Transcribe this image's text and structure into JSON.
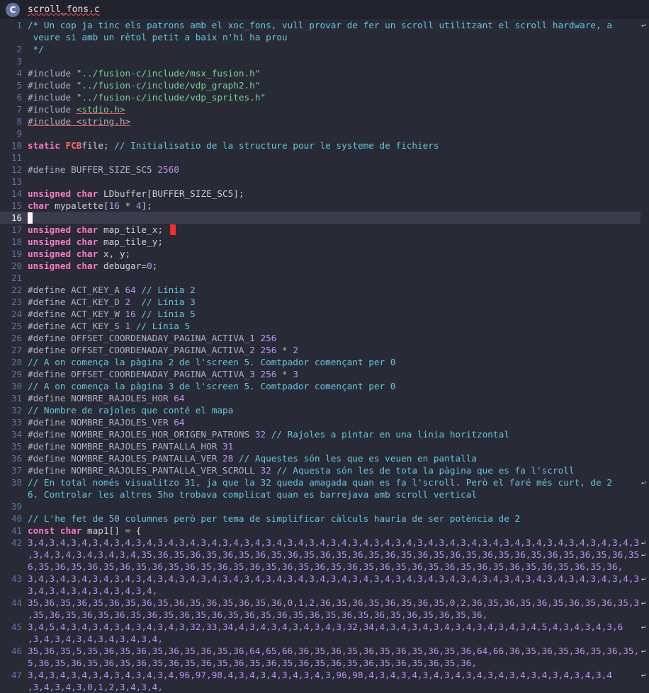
{
  "tab": {
    "icon": "c-language-icon",
    "icon_glyph": "C",
    "filename": "scroll_fons.c"
  },
  "editor": {
    "current_line": 16,
    "lines": [
      {
        "n": "1",
        "rows": [
          [
            [
              "cm",
              "/* Un cop ja tinc els patrons amb el xoc_fons, vull provar de fer un scroll utilitzant el scroll hardware, a"
            ]
          ],
          [
            [
              "cm",
              " veure si amb un rètol petit a baix n'hi ha prou"
            ]
          ]
        ]
      },
      {
        "n": "2",
        "rows": [
          [
            [
              "cm",
              " */"
            ]
          ]
        ]
      },
      {
        "n": "3",
        "rows": [
          []
        ]
      },
      {
        "n": "4",
        "rows": [
          [
            [
              "pp",
              "#include "
            ],
            [
              "str",
              "\"../fusion-c/include/msx_fusion.h\""
            ]
          ]
        ]
      },
      {
        "n": "5",
        "rows": [
          [
            [
              "pp",
              "#include "
            ],
            [
              "str",
              "\"../fusion-c/include/vdp_graph2.h\""
            ]
          ]
        ]
      },
      {
        "n": "6",
        "rows": [
          [
            [
              "pp",
              "#include "
            ],
            [
              "str",
              "\"../fusion-c/include/vdp_sprites.h\""
            ]
          ]
        ]
      },
      {
        "n": "7",
        "rows": [
          [
            [
              "pp",
              "#include "
            ],
            [
              "str",
              "<stdio.h>"
            ]
          ]
        ]
      },
      {
        "n": "8",
        "rows": [
          [
            [
              "pp",
              "#include <string.h>"
            ]
          ]
        ]
      },
      {
        "n": "9",
        "rows": [
          []
        ]
      },
      {
        "n": "10",
        "rows": [
          [
            [
              "kw",
              "static "
            ],
            [
              "ty",
              "FCB"
            ],
            [
              "",
              "file; "
            ],
            [
              "cm",
              "// Initialisatio de la structure pour le systeme de fichiers"
            ]
          ]
        ]
      },
      {
        "n": "11",
        "rows": [
          []
        ]
      },
      {
        "n": "12",
        "rows": [
          [
            [
              "pp",
              "#define BUFFER_SIZE_SC5 "
            ],
            [
              "num",
              "2560"
            ]
          ]
        ]
      },
      {
        "n": "13",
        "rows": [
          []
        ]
      },
      {
        "n": "14",
        "rows": [
          [
            [
              "kw",
              "unsigned char "
            ],
            [
              "",
              "LDbuffer[BUFFER_SIZE_SC5];"
            ]
          ]
        ]
      },
      {
        "n": "15",
        "rows": [
          [
            [
              "kw",
              "char "
            ],
            [
              "",
              "mypalette["
            ],
            [
              "num",
              "16"
            ],
            [
              "",
              " * "
            ],
            [
              "num",
              "4"
            ],
            [
              "",
              "];"
            ]
          ]
        ]
      },
      {
        "n": "16",
        "rows": [
          []
        ]
      },
      {
        "n": "17",
        "rows": [
          [
            [
              "kw",
              "unsigned char "
            ],
            [
              "",
              "map_tile_x;"
            ]
          ]
        ]
      },
      {
        "n": "18",
        "rows": [
          [
            [
              "kw",
              "unsigned char "
            ],
            [
              "",
              "map_tile_y;"
            ]
          ]
        ]
      },
      {
        "n": "19",
        "rows": [
          [
            [
              "kw",
              "unsigned char "
            ],
            [
              "",
              "x, y;"
            ]
          ]
        ]
      },
      {
        "n": "20",
        "rows": [
          [
            [
              "kw",
              "unsigned char "
            ],
            [
              "",
              "debugar="
            ],
            [
              "num",
              "0"
            ],
            [
              "",
              ";"
            ]
          ]
        ]
      },
      {
        "n": "21",
        "rows": [
          []
        ]
      },
      {
        "n": "22",
        "rows": [
          [
            [
              "pp",
              "#define ACT_KEY_A "
            ],
            [
              "num",
              "64"
            ],
            [
              "cm",
              " // Línia 2"
            ]
          ]
        ]
      },
      {
        "n": "23",
        "rows": [
          [
            [
              "pp",
              "#define ACT_KEY_D "
            ],
            [
              "num",
              "2"
            ],
            [
              "cm",
              "  // Línia 3"
            ]
          ]
        ]
      },
      {
        "n": "24",
        "rows": [
          [
            [
              "pp",
              "#define ACT_KEY_W "
            ],
            [
              "num",
              "16"
            ],
            [
              "cm",
              " // Línia 5"
            ]
          ]
        ]
      },
      {
        "n": "25",
        "rows": [
          [
            [
              "pp",
              "#define ACT_KEY_S "
            ],
            [
              "num",
              "1"
            ],
            [
              "cm",
              " // Línia 5"
            ]
          ]
        ]
      },
      {
        "n": "26",
        "rows": [
          [
            [
              "pp",
              "#define OFFSET_COORDENADAY_PAGINA_ACTIVA_1 "
            ],
            [
              "num",
              "256"
            ]
          ]
        ]
      },
      {
        "n": "27",
        "rows": [
          [
            [
              "pp",
              "#define OFFSET_COORDENADAY_PAGINA_ACTIVA_2 "
            ],
            [
              "num",
              "256"
            ],
            [
              "pp",
              " * "
            ],
            [
              "num",
              "2"
            ]
          ]
        ]
      },
      {
        "n": "28",
        "rows": [
          [
            [
              "cm",
              "// A on comença la pàgina 2 de l'screen 5. Comtpador començant per 0"
            ]
          ]
        ]
      },
      {
        "n": "29",
        "rows": [
          [
            [
              "pp",
              "#define OFFSET_COORDENADAY_PAGINA_ACTIVA_3 "
            ],
            [
              "num",
              "256"
            ],
            [
              "pp",
              " * "
            ],
            [
              "num",
              "3"
            ]
          ]
        ]
      },
      {
        "n": "30",
        "rows": [
          [
            [
              "cm",
              "// A on comença la pàgina 3 de l'screen 5. Comtpador començant per 0"
            ]
          ]
        ]
      },
      {
        "n": "31",
        "rows": [
          [
            [
              "pp",
              "#define NOMBRE_RAJOLES_HOR "
            ],
            [
              "num",
              "64"
            ]
          ]
        ]
      },
      {
        "n": "32",
        "rows": [
          [
            [
              "cm",
              "// Nombre de rajoles que conté el mapa"
            ]
          ]
        ]
      },
      {
        "n": "33",
        "rows": [
          [
            [
              "pp",
              "#define NOMBRE_RAJOLES_VER "
            ],
            [
              "num",
              "64"
            ]
          ]
        ]
      },
      {
        "n": "34",
        "rows": [
          [
            [
              "pp",
              "#define NOMBRE_RAJOLES_HOR_ORIGEN_PATRONS "
            ],
            [
              "num",
              "32"
            ],
            [
              "cm",
              " // Rajoles a pintar en una linia horitzontal"
            ]
          ]
        ]
      },
      {
        "n": "35",
        "rows": [
          [
            [
              "pp",
              "#define NOMBRE_RAJOLES_PANTALLA_HOR "
            ],
            [
              "num",
              "31"
            ]
          ]
        ]
      },
      {
        "n": "36",
        "rows": [
          [
            [
              "pp",
              "#define NOMBRE_RAJOLES_PANTALLA_VER "
            ],
            [
              "num",
              "28"
            ],
            [
              "cm",
              " // Aquestes són les que es veuen en pantalla"
            ]
          ]
        ]
      },
      {
        "n": "37",
        "rows": [
          [
            [
              "pp",
              "#define NOMBRE_RAJOLES_PANTALLA_VER_SCROLL "
            ],
            [
              "num",
              "32"
            ],
            [
              "cm",
              " // Aquesta són les de tota la pàgina que es fa l'scroll"
            ]
          ]
        ]
      },
      {
        "n": "38",
        "rows": [
          [
            [
              "cm",
              "// En total només visualitzo 31, ja que la 32 queda amagada quan es fa l'scroll. Però el faré més curt, de 2"
            ]
          ],
          [
            [
              "cm",
              "6. Controlar les altres 5ho trobava complicat quan es barrejava amb scroll vertical"
            ]
          ]
        ]
      },
      {
        "n": "39",
        "rows": [
          []
        ]
      },
      {
        "n": "40",
        "rows": [
          [
            [
              "cm",
              "// L'he fet de 50 columnes però per tema de simplificar càlculs hauria de ser potència de 2"
            ]
          ]
        ]
      },
      {
        "n": "41",
        "rows": [
          [
            [
              "kw",
              "const char "
            ],
            [
              "",
              "map1[] = {"
            ]
          ]
        ]
      },
      {
        "n": "42",
        "rows": [
          [
            [
              "num",
              "3,4,3,4,3,4,3,4,3,4,3,4,3,4,3,4,3,4,3,4,3,4,3,4,3,4,3,4,3,4,3,4,3,4,3,4,3,4,3,4,3,4,3,4,3,4,3,4,3,4,3,4,3,4,3,4,3,4,3,4,3,4,3,4,"
            ]
          ],
          [
            [
              "num",
              ",3,4,3,4,3,4,3,4,3,4,35,36,35,36,35,36,35,36,35,36,35,36,35,36,35,36,35,36,35,36,35,36,35,36,35,36,35,36,35,36,35,36,35,36,35,36,35,"
            ]
          ],
          [
            [
              "num",
              "6,35,36,35,36,35,36,35,36,35,36,35,36,35,36,35,36,35,36,35,36,35,36,35,36,35,36,35,36,35,36,35,36,35,36,35,36,"
            ]
          ]
        ]
      },
      {
        "n": "43",
        "rows": [
          [
            [
              "num",
              "3,4,3,4,3,4,3,4,3,4,3,4,3,4,3,4,3,4,3,4,3,4,3,4,3,4,3,4,3,4,3,4,3,4,3,4,3,4,3,4,3,4,3,4,3,4,3,4,3,4,3,4,3,4,3,4,3,4,3,4,3,4,3,4,"
            ]
          ],
          [
            [
              "num",
              "3,4,3,4,3,4,3,4,3,4,3,4,"
            ]
          ]
        ]
      },
      {
        "n": "44",
        "rows": [
          [
            [
              "num",
              "35,36,35,36,35,36,35,36,35,36,35,36,35,36,35,36,0,1,2,36,35,36,35,36,35,36,35,0,2,36,35,36,35,36,35,36,35,36,35,36"
            ]
          ],
          [
            [
              "num",
              ",35,36,35,36,35,36,35,36,35,36,35,36,35,36,35,36,35,36,35,36,35,36,35,36,35,36,35,36,"
            ]
          ]
        ]
      },
      {
        "n": "45",
        "rows": [
          [
            [
              "num",
              "3,4,5,4,3,4,3,4,3,4,3,4,3,4,3,32,33,34,4,3,4,3,4,3,4,3,4,3,32,34,4,3,4,3,4,3,4,3,4,3,4,3,4,3,4,5,4,3,4,3,4,3,6"
            ]
          ],
          [
            [
              "num",
              ",3,4,3,4,3,4,3,4,3,4,3,4,"
            ]
          ]
        ]
      },
      {
        "n": "46",
        "rows": [
          [
            [
              "num",
              "35,36,35,5,35,36,35,36,35,36,35,36,35,36,64,65,66,36,35,36,35,36,35,36,35,36,35,36,64,66,36,35,36,35,36,35,36,35,3"
            ]
          ],
          [
            [
              "num",
              "5,36,35,36,35,36,35,36,35,36,35,36,35,36,35,36,35,36,35,36,35,36,35,36,35,36,35,36,"
            ]
          ]
        ]
      },
      {
        "n": "47",
        "rows": [
          [
            [
              "num",
              "3,4,3,4,3,4,3,4,3,4,3,4,3,4,96,97,98,4,3,4,3,4,3,4,3,4,3,96,98,4,3,4,3,4,3,4,3,4,3,4,3,4,3,4,3,4,3,4,3,4,3,4"
            ]
          ],
          [
            [
              "num",
              ",3,4,3,4,3,0,1,2,3,4,3,4,"
            ]
          ]
        ]
      }
    ]
  }
}
